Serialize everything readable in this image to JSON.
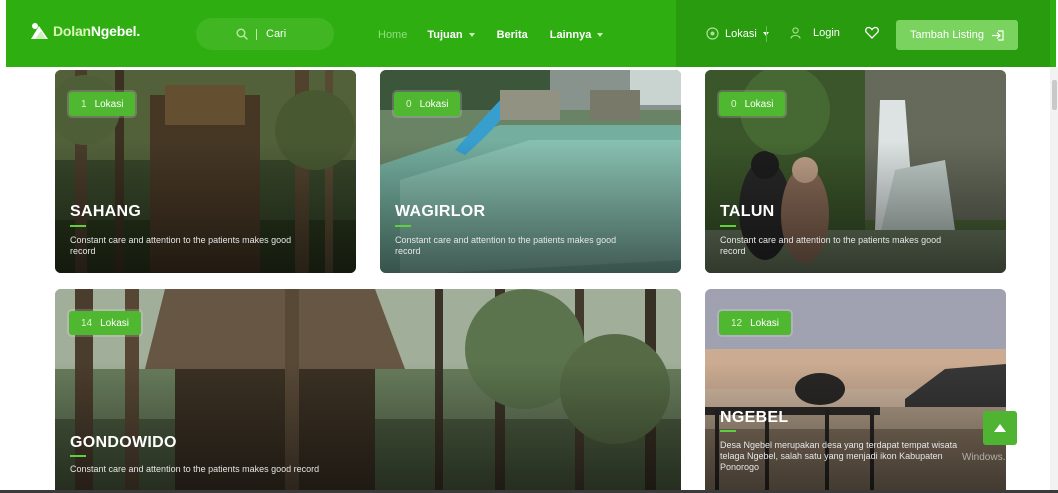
{
  "brand": {
    "name_part1": "Dolan",
    "name_part2": "Ngebel."
  },
  "search": {
    "placeholder": "Cari"
  },
  "nav": {
    "home": "Home",
    "tujuan": "Tujuan",
    "berita": "Berita",
    "lainnya": "Lainnya"
  },
  "header_right": {
    "location_label": "Lokasi",
    "login_label": "Login",
    "listing_button": "Tambah Listing"
  },
  "cards": [
    {
      "count": "1",
      "count_label": "Lokasi",
      "title": "SAHANG",
      "desc_line1": "Constant care and attention to the patients makes good",
      "desc_line2": "record"
    },
    {
      "count": "0",
      "count_label": "Lokasi",
      "title": "WAGIRLOR",
      "desc_line1": "Constant care and attention to the patients makes good",
      "desc_line2": "record"
    },
    {
      "count": "0",
      "count_label": "Lokasi",
      "title": "TALUN",
      "desc_line1": "Constant care and attention to the patients makes good",
      "desc_line2": "record"
    },
    {
      "count": "14",
      "count_label": "Lokasi",
      "title": "GONDOWIDO",
      "desc_line1": "Constant care and attention to the patients makes good record",
      "desc_line2": ""
    },
    {
      "count": "12",
      "count_label": "Lokasi",
      "title": "NGEBEL",
      "desc_line1": "Desa Ngebel merupakan desa yang terdapat tempat wisata",
      "desc_line2": "telaga Ngebel, salah satu yang menjadi ikon Kabupaten",
      "desc_line3": "Ponorogo"
    }
  ],
  "watermark": "Windows.",
  "colors": {
    "primary": "#2fae12",
    "header_dark": "#289c0e",
    "accent": "#50b830",
    "button": "#7ad25f"
  },
  "icons": [
    "logo-icon",
    "search-icon",
    "location-icon",
    "user-icon",
    "heart-icon",
    "login-arrow-icon",
    "arrow-up-icon"
  ]
}
